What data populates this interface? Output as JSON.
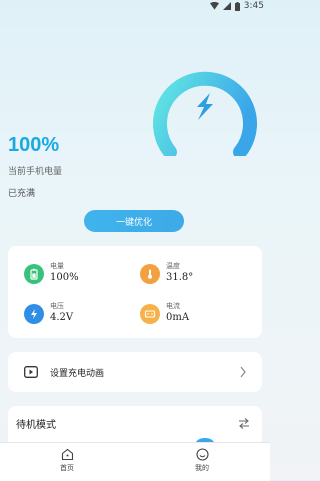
{
  "status_bar": {
    "time": "3:45"
  },
  "battery": {
    "percent_text": "100%",
    "percent_label": "当前手机电量",
    "charge_status": "已充满",
    "gauge_level": 1.0
  },
  "optimize_label": "一键优化",
  "stats": {
    "level": {
      "label": "电量",
      "value": "100%"
    },
    "temperature": {
      "label": "温度",
      "value": "31.8°"
    },
    "voltage": {
      "label": "电压",
      "value": "4.2V"
    },
    "current": {
      "label": "电流",
      "value": "0mA"
    }
  },
  "animation_row": {
    "label": "设置充电动画"
  },
  "standby": {
    "title": "待机模式"
  },
  "nav": [
    {
      "label": "首页"
    },
    {
      "label": "我的"
    }
  ],
  "colors": {
    "accent": "#3ab0ea",
    "gauge_gradient_start": "#5fe3e4",
    "gauge_gradient_end": "#3aa7ea"
  }
}
